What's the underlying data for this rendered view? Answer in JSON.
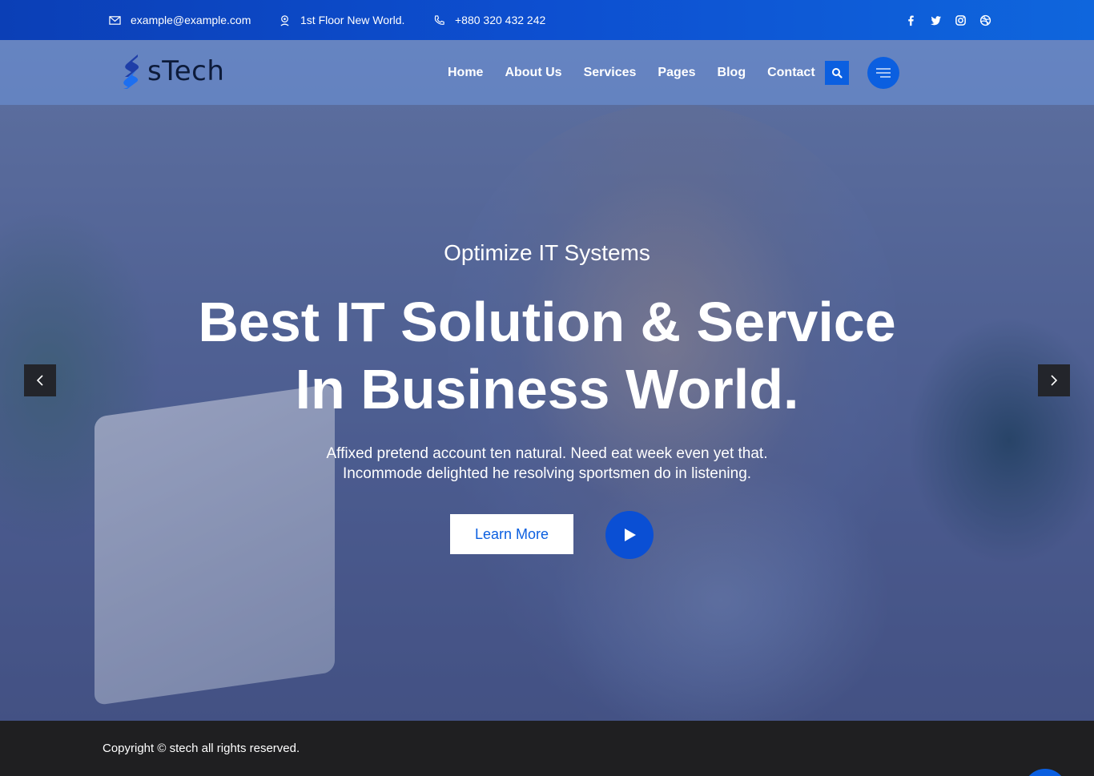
{
  "topbar": {
    "email": "example@example.com",
    "address": "1st Floor New World.",
    "phone": "+880 320 432 242",
    "socials": [
      "facebook-icon",
      "twitter-icon",
      "instagram-icon",
      "dribbble-icon"
    ]
  },
  "header": {
    "logo_text": "sTech",
    "nav": [
      "Home",
      "About Us",
      "Services",
      "Pages",
      "Blog",
      "Contact"
    ]
  },
  "hero": {
    "subtitle": "Optimize IT Systems",
    "title_line1": "Best IT Solution & Service",
    "title_line2": "In Business World.",
    "desc_line1": "Affixed pretend account ten natural. Need eat week even yet that.",
    "desc_line2": "Incommode delighted he resolving sportsmen do in listening.",
    "cta_label": "Learn More"
  },
  "footer": {
    "copyright": "Copyright © stech all rights reserved."
  },
  "colors": {
    "primary": "#0b5fe0",
    "topbar_start": "#0b3fb6",
    "footer_bg": "#1f1f21"
  }
}
